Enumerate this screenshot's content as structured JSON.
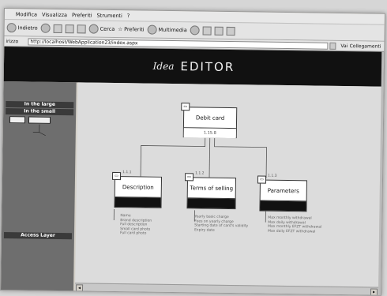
{
  "menu": [
    "Modifica",
    "Visualizza",
    "Preferiti",
    "Strumenti",
    "?"
  ],
  "toolbar": {
    "back_label": "Indietro",
    "search_label": "Cerca",
    "favorites_label": "Preferiti",
    "multimedia_label": "Multimedia"
  },
  "address": {
    "label": "irizzo",
    "url": "http://localhost/WebApplication23/index.aspx",
    "go_label": "Vai",
    "links_label": "Collegamenti"
  },
  "header": {
    "logo": "Idea",
    "title": "EDITOR"
  },
  "sidebar": {
    "btn_large": "In the large",
    "btn_small": "In the small",
    "btn_access": "Access Layer"
  },
  "diagram": {
    "root": {
      "title": "Debit card",
      "id": "1.15.8"
    },
    "children": [
      {
        "id": "1.1.1",
        "title": "Description",
        "items": [
          "Name",
          "Brand description",
          "Full description",
          "Small card photo",
          "Full card photo"
        ]
      },
      {
        "id": "1.1.2",
        "title": "Terms of selling",
        "items": [
          "Yearly basic charge",
          "Fees on yearly charge",
          "Starting date of card's validity",
          "Expiry date"
        ]
      },
      {
        "id": "1.1.3",
        "title": "Parameters",
        "items": [
          "Max monthly withdrawal",
          "Max daily withdrawal",
          "Max monthly EFZT withdrawal",
          "Max daily EFZT withdrawal"
        ]
      }
    ]
  },
  "colors": {
    "header_bg": "#111111",
    "sidebar_bg": "#6e6e6e",
    "canvas_bg": "#dcdcdc"
  }
}
